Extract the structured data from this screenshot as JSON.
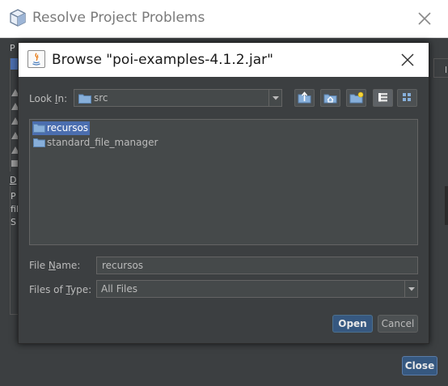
{
  "background_dialog": {
    "title": "Resolve Project Problems",
    "fragments": {
      "p1": "P",
      "d1": "D",
      "p2": "P",
      "fi": "fil",
      "s": "S",
      "right": "l"
    },
    "close_button_label": "Close"
  },
  "browse_dialog": {
    "title": "Browse \"poi-examples-4.1.2.jar\"",
    "look_in": {
      "label_prefix": "Look ",
      "label_mnemonic": "I",
      "label_suffix": "n:",
      "value": "src"
    },
    "toolbar": [
      "up-one-level-icon",
      "home-icon",
      "new-folder-icon",
      "list-view-icon",
      "details-view-icon"
    ],
    "files": [
      {
        "name": "recursos",
        "selected": true
      },
      {
        "name": "standard_file_manager",
        "selected": false
      }
    ],
    "file_name": {
      "label_prefix": "File ",
      "label_mnemonic": "N",
      "label_suffix": "ame:",
      "value": "recursos"
    },
    "files_of_type": {
      "label_prefix": "Files of ",
      "label_mnemonic": "T",
      "label_suffix": "ype:",
      "value": "All Files"
    },
    "open_label": "Open",
    "cancel_label": "Cancel"
  },
  "colors": {
    "accent": "#365880",
    "selection": "#4b6eaf",
    "panel": "#3c3f41",
    "field": "#45494a"
  }
}
